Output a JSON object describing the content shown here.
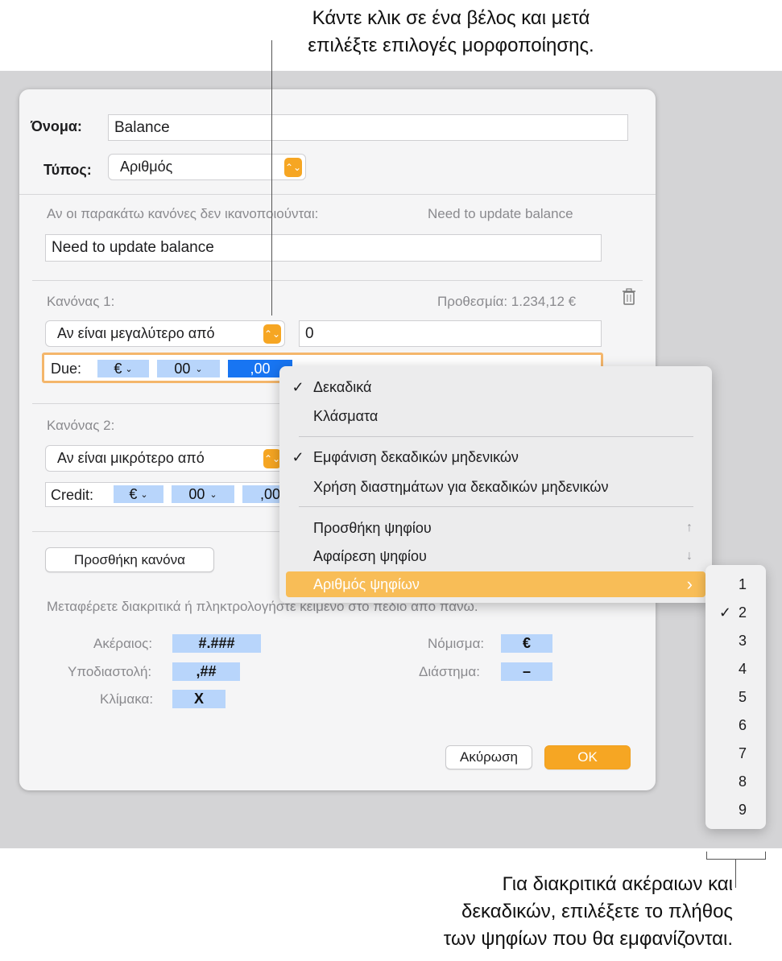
{
  "callouts": {
    "top_line1": "Κάντε κλικ σε ένα βέλος και μετά",
    "top_line2": "επιλέξτε επιλογές μορφοποίησης.",
    "bottom_line1": "Για διακριτικά ακέραιων και",
    "bottom_line2": "δεκαδικών, επιλέξετε το πλήθος",
    "bottom_line3": "των ψηφίων που θα εμφανίζονται."
  },
  "dialog": {
    "name_label": "Όνομα:",
    "name_value": "Balance",
    "type_label": "Τύπος:",
    "type_value": "Αριθμός",
    "unmet_label": "Αν οι παρακάτω κανόνες δεν ικανοποιούνται:",
    "unmet_preview": "Need to update balance",
    "unmet_value": "Need to update balance",
    "rule1": {
      "label": "Κανόνας 1:",
      "preview": "Προθεσμία: 1.234,12 €",
      "condition": "Αν είναι μεγαλύτερο από",
      "value": "0",
      "format_prefix": "Due:",
      "tokens": [
        "€",
        "00",
        ",00"
      ]
    },
    "rule2": {
      "label": "Κανόνας 2:",
      "condition": "Αν είναι μικρότερο από",
      "format_prefix": "Credit:",
      "tokens": [
        "€",
        "00",
        ",00"
      ]
    },
    "add_rule_button": "Προσθήκη κανόνα",
    "hint": "Μεταφέρετε διακριτικά ή πληκτρολογήστε κείμενο στο πεδίο από πάνω.",
    "tokens_legend": {
      "integer_label": "Ακέραιος:",
      "integer_token": "#.###",
      "decimal_label": "Υποδιαστολή:",
      "decimal_token": ",##",
      "scale_label": "Κλίμακα:",
      "scale_token": "X",
      "currency_label": "Νόμισμα:",
      "currency_token": "€",
      "space_label": "Διάστημα:",
      "space_token": "–"
    },
    "cancel_button": "Ακύρωση",
    "ok_button": "OK"
  },
  "menu": {
    "items": [
      {
        "label": "Δεκαδικά",
        "checked": true
      },
      {
        "label": "Κλάσματα",
        "checked": false
      },
      {
        "label": "Εμφάνιση δεκαδικών μηδενικών",
        "checked": true
      },
      {
        "label": "Χρήση διαστημάτων για δεκαδικών μηδενικών",
        "checked": false
      },
      {
        "label": "Προσθήκη ψηφίου",
        "key": "↑"
      },
      {
        "label": "Αφαίρεση ψηφίου",
        "key": "↓"
      },
      {
        "label": "Αριθμός ψηφίων",
        "submenu_arrow": "›",
        "highlighted": true
      }
    ]
  },
  "submenu": {
    "items": [
      "1",
      "2",
      "3",
      "4",
      "5",
      "6",
      "7",
      "8",
      "9"
    ],
    "checked": "2",
    "check_glyph": "✓"
  },
  "colors": {
    "accent": "#f6a623",
    "token_bg": "#b8d5fb",
    "token_selected": "#1875f2",
    "menu_highlight": "#f8bd57"
  },
  "icons": [
    "trash-icon",
    "stepper-icon",
    "chevron-down-icon",
    "checkmark-icon",
    "chevron-right-icon"
  ]
}
